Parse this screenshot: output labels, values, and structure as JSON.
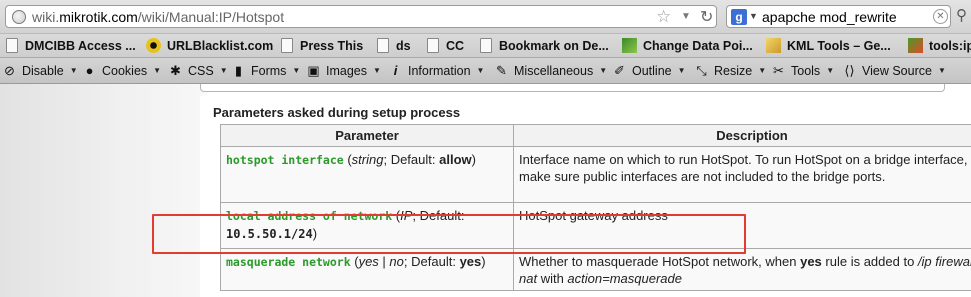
{
  "url": {
    "prefix": "wiki.",
    "domain": "mikrotik.com",
    "path": "/wiki/Manual:IP/Hotspot"
  },
  "search": {
    "query": "apapche mod_rewrite",
    "engine_letter": "g"
  },
  "bookmarks": [
    "DMCIBB Access ...",
    "URLBlacklist.com",
    "Press This",
    "ds",
    "CC",
    "Bookmark on De...",
    "Change Data Poi...",
    "KML Tools – Ge...",
    "tools:ip"
  ],
  "webdev": {
    "disable": "Disable",
    "cookies": "Cookies",
    "css": "CSS",
    "forms": "Forms",
    "images": "Images",
    "information": "Information",
    "miscellaneous": "Miscellaneous",
    "outline": "Outline",
    "resize": "Resize",
    "tools": "Tools",
    "view_source": "View Source"
  },
  "section_title": "Parameters asked during setup process",
  "table": {
    "headers": {
      "parameter": "Parameter",
      "description": "Description"
    },
    "rows": [
      {
        "name": "hotspot interface",
        "type": "string",
        "default_label": "Default:",
        "default_value": "allow",
        "description": "Interface name on which to run HotSpot. To run HotSpot on a bridge interface, make sure public interfaces are not included to the bridge ports."
      },
      {
        "name": "local address of network",
        "type": "IP",
        "default_label": "Default:",
        "default_value": "10.5.50.1/24",
        "description": "HotSpot gateway address"
      },
      {
        "name": "masquerade network",
        "type_a": "yes",
        "type_sep": " | ",
        "type_b": "no",
        "default_label": "Default:",
        "default_value": "yes",
        "desc_a": "Whether to masquerade HotSpot network, when ",
        "desc_b": "yes",
        "desc_c": " rule is added to ",
        "desc_d": "/ip firewall nat",
        "desc_e": " with ",
        "desc_f": "action=masquerade"
      }
    ]
  },
  "colors": {
    "code_green": "#2a9a2a",
    "highlight_red": "#e23b30"
  }
}
